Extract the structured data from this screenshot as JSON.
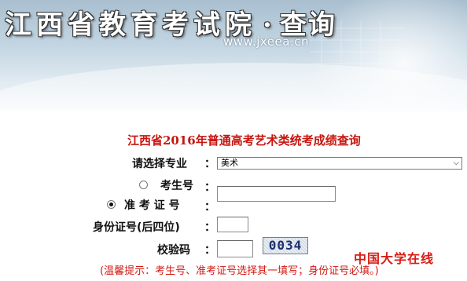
{
  "banner": {
    "title": "江西省教育考试院",
    "dot": "·",
    "query": "查询",
    "url": "www.jxeea.cn"
  },
  "form": {
    "title": "江西省2016年普通高考艺术类统考成绩查询",
    "major_label": "请选择专业",
    "major_selected": "美术",
    "exam_no_label": "考生号",
    "admission_ticket_label": "准 考 证 号",
    "id_last4_label": "身份证号(后四位)",
    "captcha_label": "校验码",
    "colon": "：",
    "captcha_text": "0034",
    "exam_no_value": "",
    "id_last4_value": "",
    "captcha_value": "",
    "selected_id_type": "admission_ticket"
  },
  "hint": "(温馨提示：考生号、准考证号选择其一填写；身份证号必填。)",
  "watermark": "中国大学在线",
  "colors": {
    "title_red": "#c8150f",
    "hint_red": "#d11b14",
    "banner_blue": "#a9bfcf"
  }
}
